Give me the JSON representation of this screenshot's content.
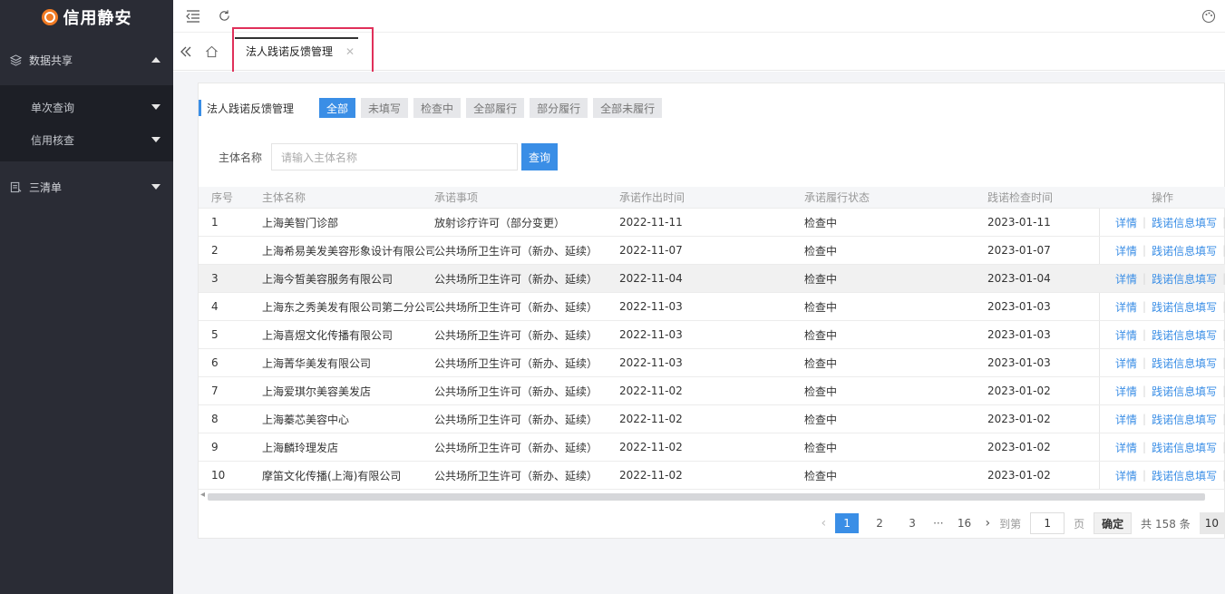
{
  "app": {
    "title": "信用静安"
  },
  "sidebar": {
    "items": [
      {
        "label": "数据共享",
        "icon": "layers-icon",
        "expanded": true,
        "children": [
          {
            "label": "单次查询"
          },
          {
            "label": "信用核查"
          }
        ]
      },
      {
        "label": "三清单",
        "icon": "list-icon",
        "expanded": false
      }
    ]
  },
  "tabs": [
    {
      "label": "法人践诺反馈管理",
      "active": true
    }
  ],
  "page": {
    "title": "法人践诺反馈管理",
    "filters": [
      "全部",
      "未填写",
      "检查中",
      "全部履行",
      "部分履行",
      "全部未履行"
    ],
    "active_filter": "全部",
    "search": {
      "label": "主体名称",
      "placeholder": "请输入主体名称",
      "button": "查询"
    }
  },
  "table": {
    "columns": [
      "序号",
      "主体名称",
      "承诺事项",
      "承诺作出时间",
      "承诺履行状态",
      "践诺检查时间",
      "操作"
    ],
    "ops": {
      "detail": "详情",
      "fill": "践诺信息填写"
    },
    "rows": [
      {
        "idx": "1",
        "name": "上海美智门诊部",
        "item": "放射诊疗许可（部分变更）",
        "time": "2022-11-11",
        "status": "检查中",
        "check": "2023-01-11"
      },
      {
        "idx": "2",
        "name": "上海希易美发美容形象设计有限公司",
        "item": "公共场所卫生许可（新办、延续）",
        "time": "2022-11-07",
        "status": "检查中",
        "check": "2023-01-07"
      },
      {
        "idx": "3",
        "name": "上海今皙美容服务有限公司",
        "item": "公共场所卫生许可（新办、延续）",
        "time": "2022-11-04",
        "status": "检查中",
        "check": "2023-01-04"
      },
      {
        "idx": "4",
        "name": "上海东之秀美发有限公司第二分公司",
        "item": "公共场所卫生许可（新办、延续）",
        "time": "2022-11-03",
        "status": "检查中",
        "check": "2023-01-03"
      },
      {
        "idx": "5",
        "name": "上海喜煜文化传播有限公司",
        "item": "公共场所卫生许可（新办、延续）",
        "time": "2022-11-03",
        "status": "检查中",
        "check": "2023-01-03"
      },
      {
        "idx": "6",
        "name": "上海菁华美发有限公司",
        "item": "公共场所卫生许可（新办、延续）",
        "time": "2022-11-03",
        "status": "检查中",
        "check": "2023-01-03"
      },
      {
        "idx": "7",
        "name": "上海爱琪尔美容美发店",
        "item": "公共场所卫生许可（新办、延续）",
        "time": "2022-11-02",
        "status": "检查中",
        "check": "2023-01-02"
      },
      {
        "idx": "8",
        "name": "上海蓁芯美容中心",
        "item": "公共场所卫生许可（新办、延续）",
        "time": "2022-11-02",
        "status": "检查中",
        "check": "2023-01-02"
      },
      {
        "idx": "9",
        "name": "上海麟玲理发店",
        "item": "公共场所卫生许可（新办、延续）",
        "time": "2022-11-02",
        "status": "检查中",
        "check": "2023-01-02"
      },
      {
        "idx": "10",
        "name": "摩笛文化传播(上海)有限公司",
        "item": "公共场所卫生许可（新办、延续）",
        "time": "2022-11-02",
        "status": "检查中",
        "check": "2023-01-02"
      }
    ]
  },
  "pagination": {
    "pages": [
      "1",
      "2",
      "3"
    ],
    "ellipsis": "···",
    "last_page": "16",
    "current_page": "1",
    "goto_label": "到第",
    "goto_value": "1",
    "page_unit": "页",
    "confirm": "确定",
    "total": "共 158 条",
    "page_size": "10"
  },
  "colors": {
    "sidebar_bg": "#2a2c35",
    "accent": "#3a8ee6",
    "tab_highlight": "#e0305a"
  }
}
